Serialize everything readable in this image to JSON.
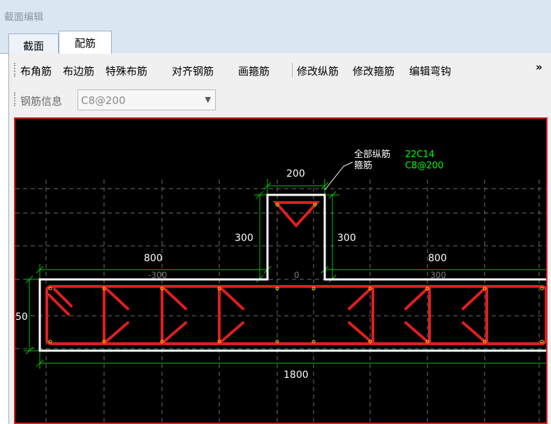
{
  "window": {
    "title": "截面编辑"
  },
  "tabs": [
    {
      "label": "截面",
      "active": false
    },
    {
      "label": "配筋",
      "active": true
    }
  ],
  "toolbar": {
    "buttons": [
      "布角筋",
      "布边筋",
      "特殊布筋",
      "对齐钢筋",
      "画箍筋",
      "修改纵筋",
      "修改箍筋",
      "编辑弯钩"
    ],
    "overflow": "»"
  },
  "rebar_info": {
    "label": "钢筋信息",
    "value": "C8@200"
  },
  "drawing": {
    "legend": {
      "longitudinal_label": "全部纵筋",
      "longitudinal_value": "22C14",
      "stirrup_label": "箍筋",
      "stirrup_value": "C8@200"
    },
    "dimensions": {
      "top_width": "200",
      "left_height": "300",
      "right_height": "300",
      "left_flange": "800",
      "right_flange": "800",
      "total_width": "1800",
      "flange_height_partial": "50",
      "grid_left": "-300",
      "grid_right": "300",
      "origin": "0"
    },
    "colors": {
      "background": "#000000",
      "outline": "#ffffff",
      "rebar": "#e01e1e",
      "dimension": "#00c800",
      "label": "#00ff00",
      "rebar_dot": "#ffd200"
    }
  }
}
